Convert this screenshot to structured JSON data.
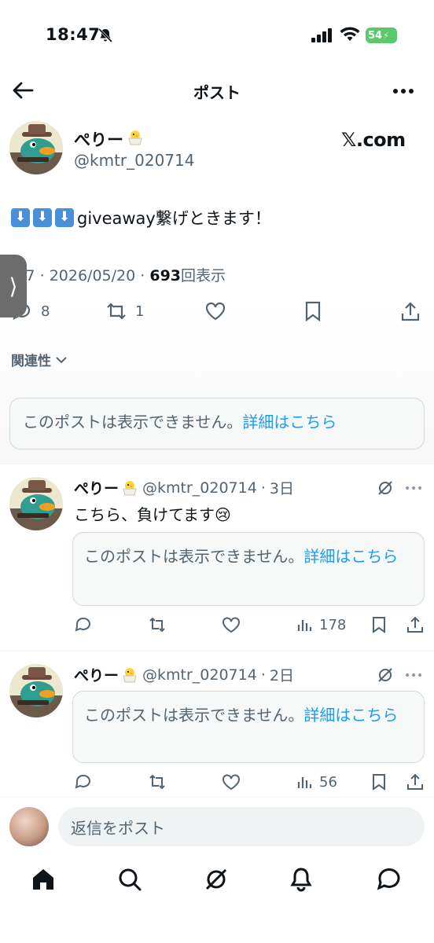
{
  "status_bar": {
    "time": "18:47",
    "battery": "54"
  },
  "nav": {
    "title": "ポスト"
  },
  "post": {
    "display_name": "ぺりー",
    "handle": "@kmtr_020714",
    "source_label": "𝕏.com",
    "text": "giveaway繋げときます！",
    "time_partial": ":57",
    "date": "2026/05/20",
    "views": "693",
    "views_label": "回表示",
    "replies": "8",
    "reposts": "1"
  },
  "sort": {
    "label": "関連性"
  },
  "quoted_unavailable": {
    "text": "このポストは表示できません。",
    "link": "詳細はこちら"
  },
  "replies": [
    {
      "display_name": "ぺりー",
      "handle": "@kmtr_020714",
      "age": "3日",
      "text": "こちら、負けてます😢",
      "unavailable_text": "このポストは表示できません。",
      "unavailable_link": "詳細はこちら",
      "views": "178"
    },
    {
      "display_name": "ぺりー",
      "handle": "@kmtr_020714",
      "age": "2日",
      "text": "",
      "unavailable_text": "このポストは表示できません。",
      "unavailable_link": "詳細はこちら",
      "views": "56"
    }
  ],
  "compose": {
    "placeholder": "返信をポスト"
  },
  "colors": {
    "accent": "#1d9bf0",
    "battery": "#5ac86b",
    "muted": "#536471"
  },
  "icons": [
    "back-arrow-icon",
    "more-icon",
    "reply-icon",
    "repost-icon",
    "like-icon",
    "bookmark-icon",
    "share-icon",
    "views-icon",
    "grok-icon",
    "home-icon",
    "search-icon",
    "bell-icon",
    "messages-icon"
  ]
}
